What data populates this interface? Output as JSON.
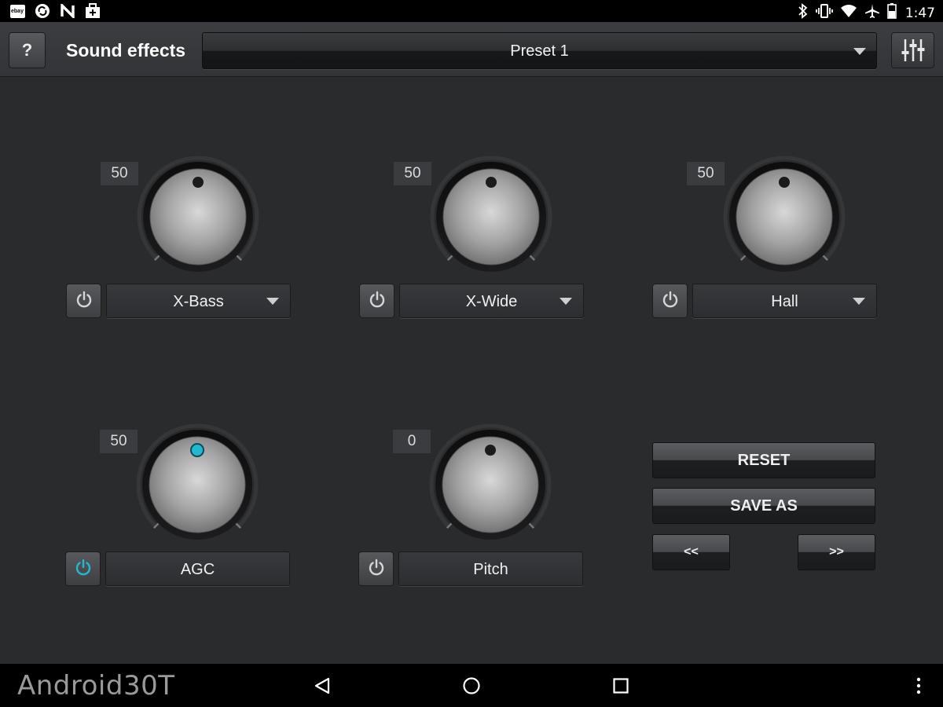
{
  "status_bar": {
    "left_icons": [
      "ebay-icon",
      "sync-icon",
      "n-app-icon",
      "briefcase-icon"
    ],
    "ebay_text": "ebay",
    "right_icons": [
      "bluetooth-icon",
      "vibrate-icon",
      "wifi-icon",
      "airplane-icon",
      "battery-icon"
    ],
    "time": "1:47"
  },
  "action_bar": {
    "help_label": "?",
    "title": "Sound effects",
    "preset_value": "Preset 1",
    "eq_icon": "equalizer-icon"
  },
  "effects": [
    {
      "id": "xbass",
      "value": "50",
      "label": "X-Bass",
      "enabled": false,
      "has_dropdown": true,
      "level": 0.5
    },
    {
      "id": "xwide",
      "value": "50",
      "label": "X-Wide",
      "enabled": false,
      "has_dropdown": true,
      "level": 0.5
    },
    {
      "id": "hall",
      "value": "50",
      "label": "Hall",
      "enabled": false,
      "has_dropdown": true,
      "level": 0.5
    },
    {
      "id": "agc",
      "value": "50",
      "label": "AGC",
      "enabled": true,
      "has_dropdown": false,
      "level": 0.5
    },
    {
      "id": "pitch",
      "value": "0",
      "label": "Pitch",
      "enabled": false,
      "has_dropdown": false,
      "level": 0.5
    }
  ],
  "buttons": {
    "reset": "RESET",
    "save_as": "SAVE AS",
    "prev": "<<",
    "next": ">>"
  },
  "nav_bar": {
    "watermark": "Android30T",
    "back_icon": "back-icon",
    "home_icon": "home-icon",
    "recents_icon": "recents-icon",
    "menu_icon": "overflow-menu-icon"
  },
  "colors": {
    "accent_active": "#22b8cf",
    "background": "#2a2b2d"
  }
}
